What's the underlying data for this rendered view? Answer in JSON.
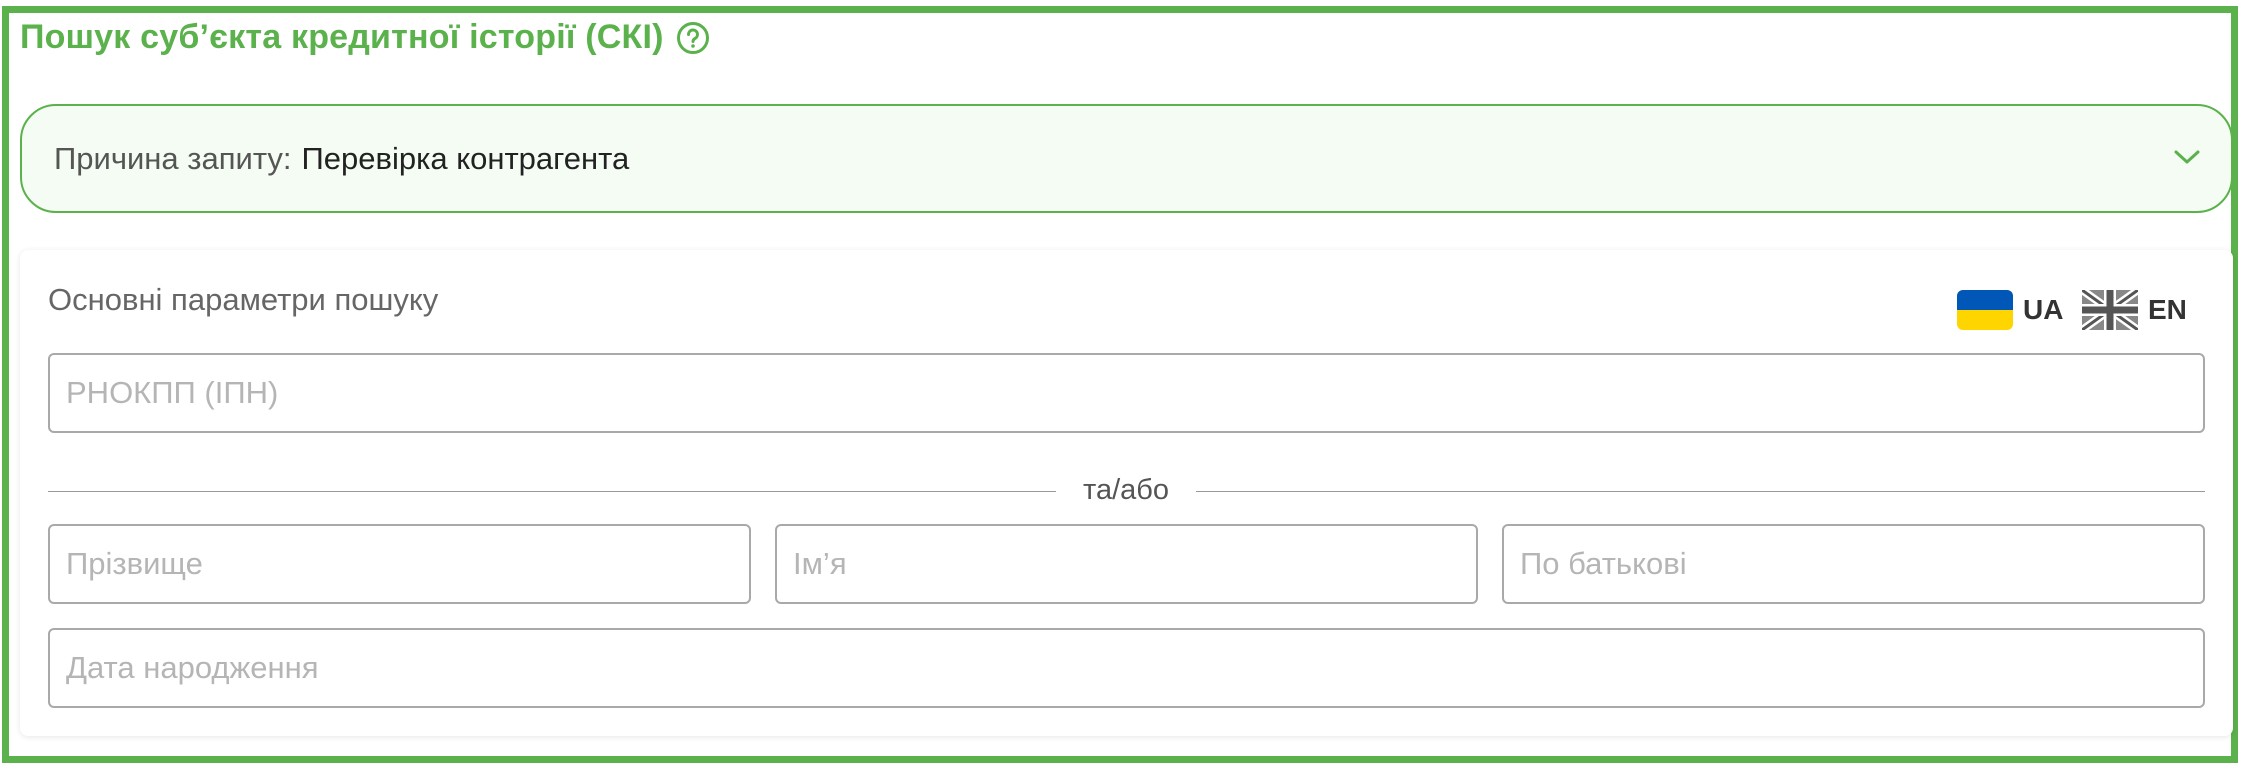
{
  "header": {
    "title": "Пошук суб’єкта кредитної історії (СКІ)",
    "help_icon": "question-circle-icon"
  },
  "reason": {
    "label": "Причина запиту:",
    "value": "Перевірка контрагента",
    "icon": "chevron-down-icon"
  },
  "search": {
    "section_title": "Основні параметри пошуку",
    "languages": [
      {
        "code": "UA",
        "icon": "ukraine-flag-icon"
      },
      {
        "code": "EN",
        "icon": "uk-flag-icon"
      }
    ],
    "rnokpp_placeholder": "РНОКПП (ІПН)",
    "divider_text": "та/або",
    "surname_placeholder": "Прізвище",
    "name_placeholder": "Ім’я",
    "patronymic_placeholder": "По батькові",
    "dob_placeholder": "Дата народження"
  },
  "colors": {
    "accent": "#5bb14b",
    "reason_bg": "#f4fcf3",
    "field_border": "#a9a9a9"
  }
}
